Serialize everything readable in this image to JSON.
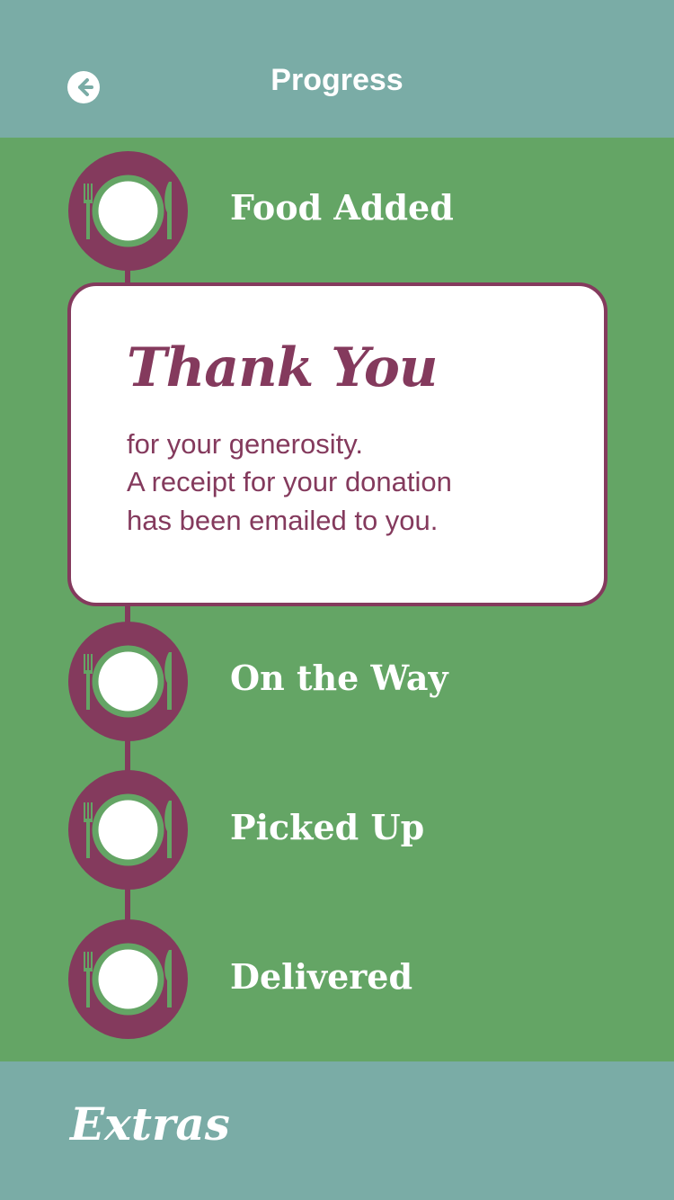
{
  "header": {
    "title": "Progress",
    "back_icon": "arrow-left-circle-icon"
  },
  "colors": {
    "header_bg": "#7aaca6",
    "main_bg": "#64a565",
    "accent": "#843a5d",
    "plate": "#ffffff",
    "card_bg": "#ffffff"
  },
  "steps": [
    {
      "label": "Food Added",
      "icon": "plate-cutlery-icon"
    },
    {
      "label": "On the Way",
      "icon": "plate-cutlery-icon"
    },
    {
      "label": "Picked Up",
      "icon": "plate-cutlery-icon"
    },
    {
      "label": "Delivered",
      "icon": "plate-cutlery-icon"
    }
  ],
  "thank_you": {
    "heading": "Thank You",
    "lines": [
      "for your generosity.",
      "A receipt for your donation",
      "has been emailed to you."
    ]
  },
  "footer": {
    "extras_label": "Extras"
  }
}
